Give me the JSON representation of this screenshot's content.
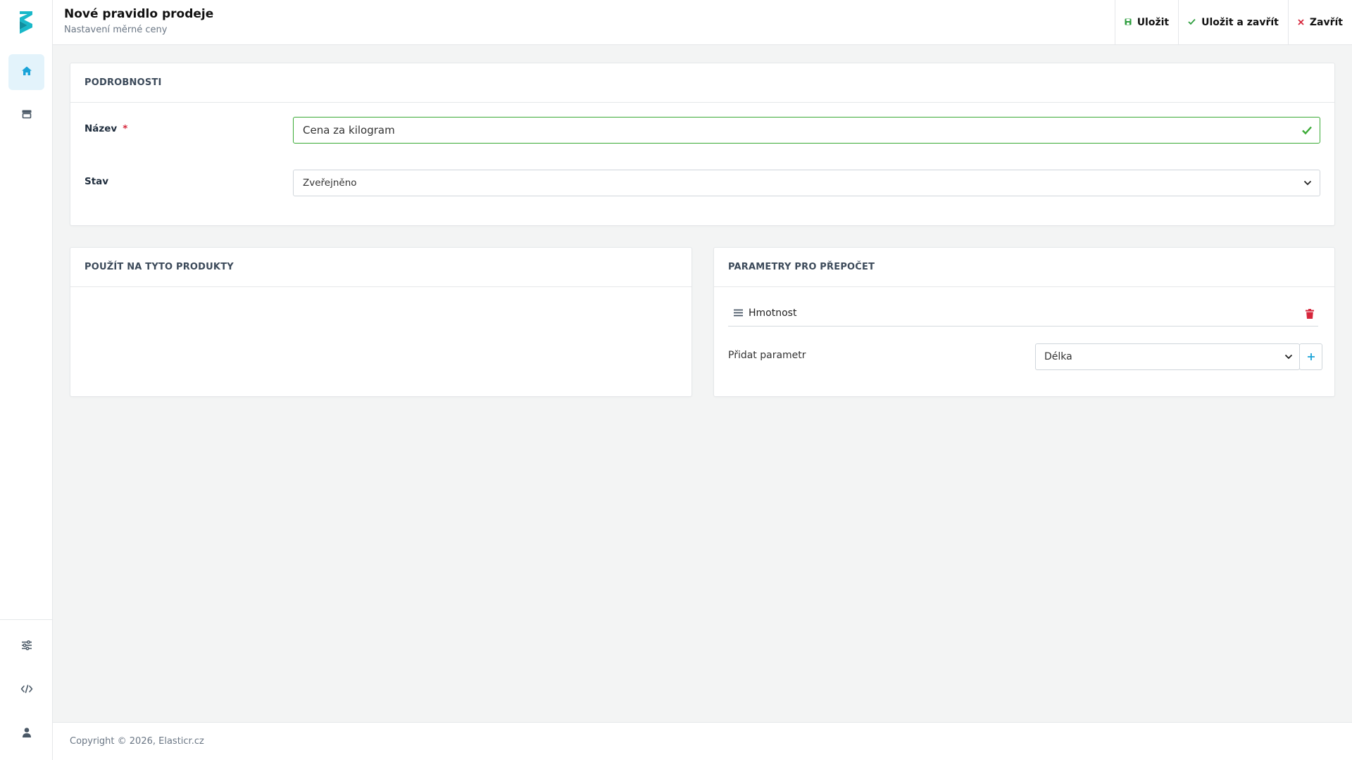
{
  "header": {
    "title": "Nové pravidlo prodeje",
    "subtitle": "Nastavení měrné ceny",
    "actions": {
      "save": "Uložit",
      "save_close": "Uložit a zavřít",
      "close": "Zavřít"
    }
  },
  "sidebar": {
    "top_items": [
      "home-icon",
      "store-icon"
    ],
    "bottom_items": [
      "sliders-icon",
      "code-icon",
      "user-icon"
    ]
  },
  "details": {
    "heading": "PODROBNOSTI",
    "name_label": "Název",
    "required_mark": "*",
    "name_value": "Cena za kilogram",
    "status_label": "Stav",
    "status_value": "Zveřejněno"
  },
  "products": {
    "heading": "POUŽÍT NA TYTO PRODUKTY"
  },
  "parameters": {
    "heading": "PARAMETRY PRO PŘEPOČET",
    "items": [
      "Hmotnost"
    ],
    "add_label": "Přidat parametr",
    "add_select_value": "Délka"
  },
  "footer": {
    "copyright": "Copyright © 2026, Elasticr.cz"
  },
  "colors": {
    "accent": "#1aa3d8",
    "success": "#3aaa35",
    "danger": "#d6263b",
    "logo": "#19b8c9"
  }
}
